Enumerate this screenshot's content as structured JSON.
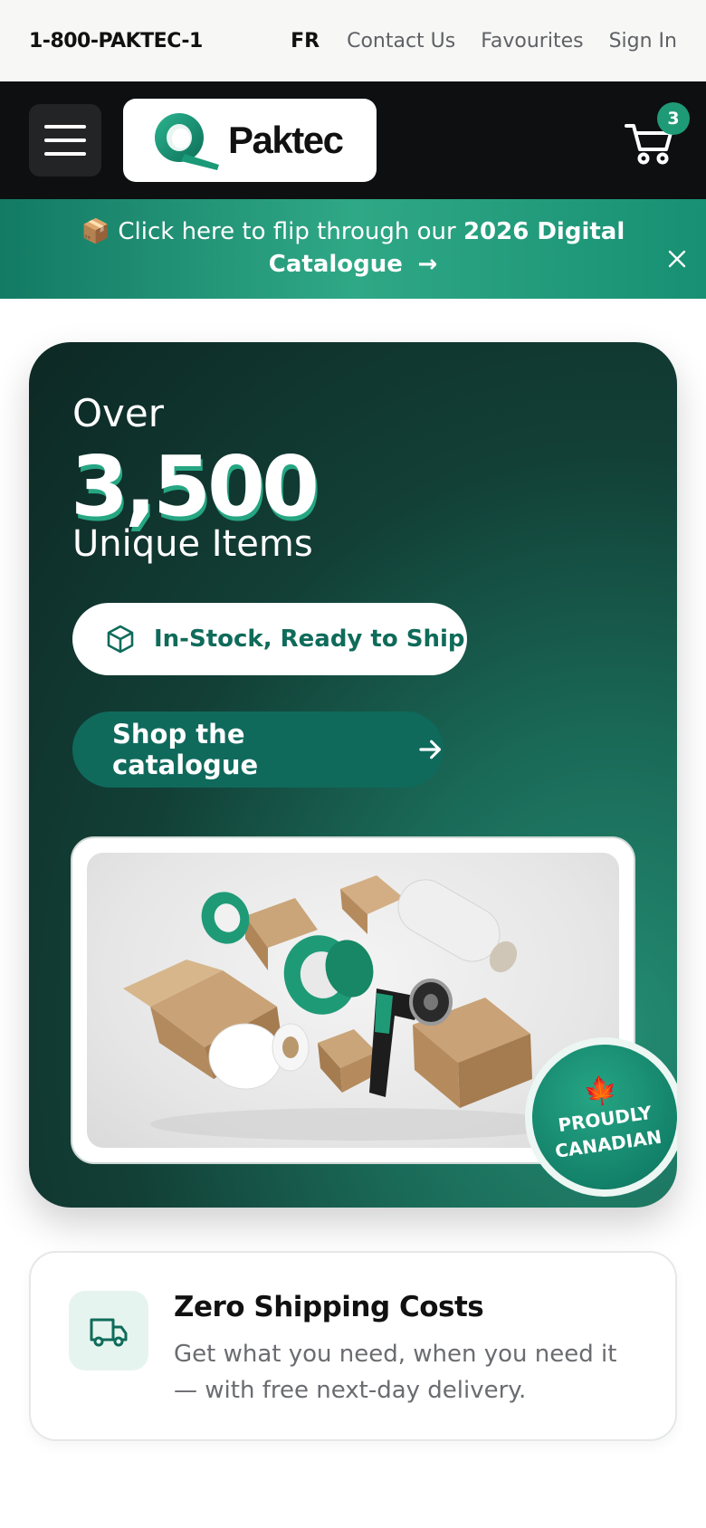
{
  "utility_bar": {
    "phone": "1-800-PAKTEC-1",
    "language": "FR",
    "contact": "Contact Us",
    "favourites": "Favourites",
    "sign_in": "Sign In"
  },
  "header": {
    "logo_text": "Paktec",
    "cart_count": "3"
  },
  "promo": {
    "emoji": "📦",
    "text": "Click here to flip through our",
    "highlight": "2026 Digital Catalogue",
    "arrow": "→"
  },
  "hero": {
    "over": "Over",
    "number": "3,500",
    "items": "Unique Items",
    "instock_label": "In-Stock, Ready to Ship",
    "shop_label": "Shop the catalogue",
    "badge_line1": "PROUDLY",
    "badge_line2": "CANADIAN"
  },
  "feature": {
    "title": "Zero Shipping Costs",
    "description": "Get what you need, when you need it — with free next-day delivery."
  },
  "colors": {
    "accent": "#1f9a77",
    "dark_green": "#0f6a5c",
    "header_bg": "#0e0f10"
  }
}
